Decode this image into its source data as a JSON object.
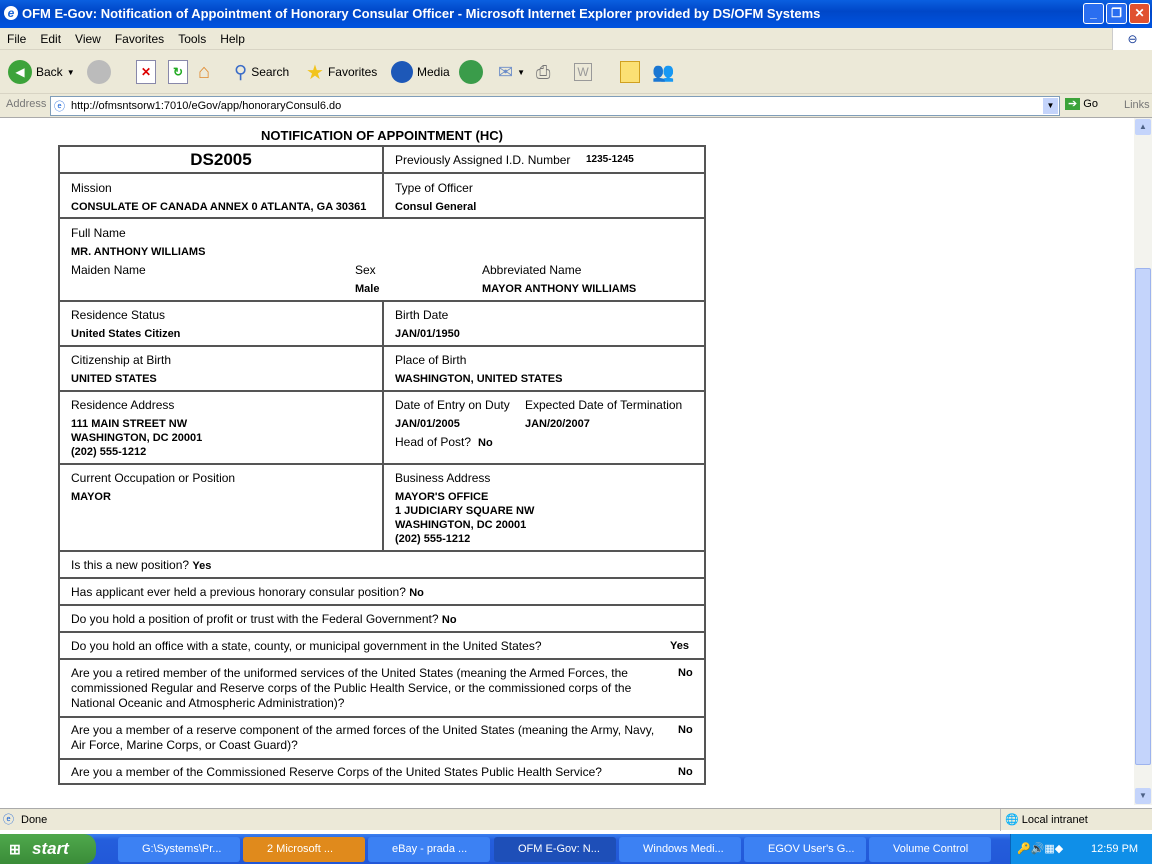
{
  "window": {
    "title": "OFM E-Gov: Notification of Appointment of Honorary Consular Officer - Microsoft Internet Explorer provided by DS/OFM Systems"
  },
  "menu": [
    "File",
    "Edit",
    "View",
    "Favorites",
    "Tools",
    "Help"
  ],
  "toolbar": {
    "back": "Back",
    "search": "Search",
    "favorites": "Favorites",
    "media": "Media"
  },
  "address": {
    "label": "Address",
    "url": "http://ofmsntsorw1:7010/eGov/app/honoraryConsul6.do",
    "go": "Go",
    "links": "Links"
  },
  "form": {
    "title": "NOTIFICATION OF APPOINTMENT (HC)",
    "form_number": "DS2005",
    "prev_id_label": "Previously Assigned I.D. Number",
    "prev_id": "1235-1245",
    "mission_label": "Mission",
    "mission": "CONSULATE OF CANADA ANNEX 0 ATLANTA, GA 30361",
    "officer_type_label": "Type of Officer",
    "officer_type": "Consul General",
    "full_name_label": "Full Name",
    "full_name": "MR. ANTHONY WILLIAMS",
    "maiden_label": "Maiden Name",
    "sex_label": "Sex",
    "sex": "Male",
    "abbrev_label": "Abbreviated Name",
    "abbrev": "MAYOR ANTHONY WILLIAMS",
    "residence_status_label": "Residence Status",
    "residence_status": "United States Citizen",
    "birth_date_label": "Birth Date",
    "birth_date": "JAN/01/1950",
    "citizenship_label": "Citizenship at Birth",
    "citizenship": "UNITED STATES",
    "birth_place_label": "Place of Birth",
    "birth_place": "WASHINGTON, UNITED STATES",
    "res_addr_label": "Residence Address",
    "res_addr": [
      "111 MAIN STREET NW",
      "WASHINGTON, DC 20001",
      "(202) 555-1212"
    ],
    "entry_label": "Date of Entry on Duty",
    "entry": "JAN/01/2005",
    "term_label": "Expected Date of Termination",
    "term": "JAN/20/2007",
    "head_label": "Head of Post?",
    "head": "No",
    "occupation_label": "Current Occupation or Position",
    "occupation": "MAYOR",
    "bus_addr_label": "Business Address",
    "bus_addr": [
      "MAYOR'S OFFICE",
      "1 JUDICIARY SQUARE NW",
      "WASHINGTON, DC 20001",
      "(202) 555-1212"
    ],
    "questions": [
      {
        "q": "Is this a new position?",
        "a": "Yes"
      },
      {
        "q": "Has applicant ever held a previous honorary consular position?",
        "a": "No"
      },
      {
        "q": "Do you hold a position of profit or trust with the Federal Government?",
        "a": "No"
      },
      {
        "q": "Do you hold an office with a state, county, or municipal government in the United States?",
        "a": "Yes"
      },
      {
        "q": "Are you a retired member of the uniformed services of the United States (meaning the Armed Forces, the commissioned Regular and Reserve corps of the Public Health Service, or the commissioned corps of the National Oceanic and Atmospheric Administration)?",
        "a": "No"
      },
      {
        "q": "Are you a member of a reserve component of the armed forces of the United States (meaning the Army, Navy, Air Force, Marine Corps, or Coast Guard)?",
        "a": "No"
      },
      {
        "q": "Are you a member of the Commissioned Reserve Corps of the United States Public Health Service?",
        "a": "No"
      }
    ]
  },
  "status": {
    "text": "Done",
    "zone": "Local intranet"
  },
  "taskbar": {
    "start": "start",
    "items": [
      "G:\\Systems\\Pr...",
      "2 Microsoft ...",
      "eBay - prada ...",
      "OFM E-Gov: N...",
      "Windows Medi...",
      "EGOV User's G...",
      "Volume Control"
    ],
    "clock": "12:59 PM"
  }
}
